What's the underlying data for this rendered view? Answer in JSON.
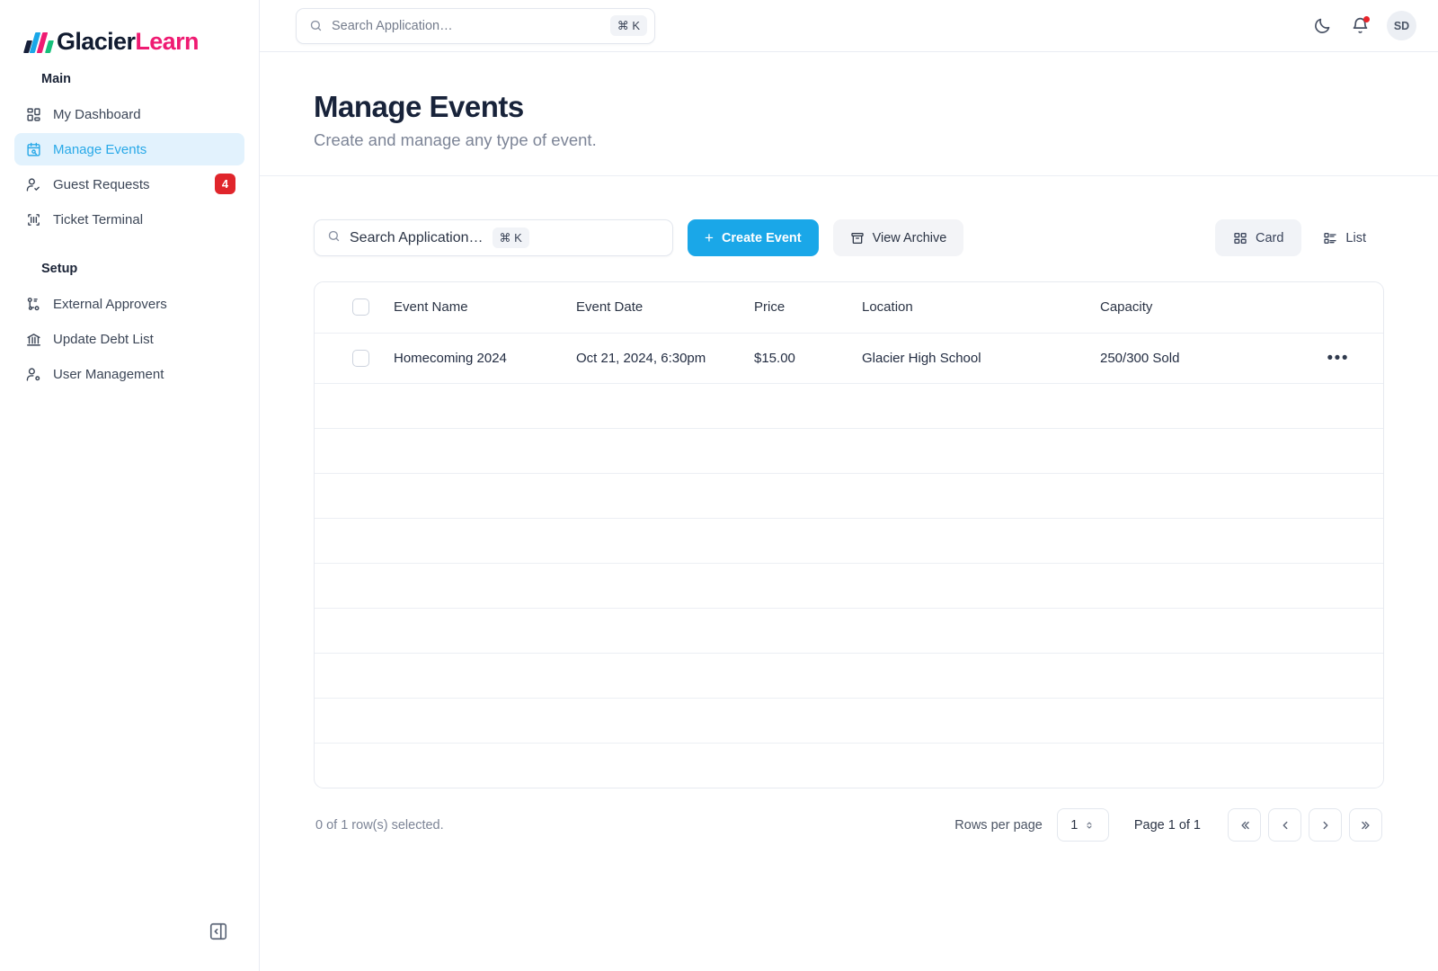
{
  "brand": {
    "name_part1": "Glacier",
    "name_part2": "Learn",
    "colors": {
      "accent_blue": "#1aa7e8",
      "accent_pink": "#ef1b72",
      "accent_green": "#17c07b",
      "badge_red": "#e0252b"
    }
  },
  "sidebar": {
    "sections": [
      {
        "title": "Main",
        "items": [
          {
            "label": "My Dashboard",
            "icon": "dashboard-icon",
            "active": false,
            "badge": null
          },
          {
            "label": "Manage Events",
            "icon": "calendar-search-icon",
            "active": true,
            "badge": null
          },
          {
            "label": "Guest Requests",
            "icon": "user-check-icon",
            "active": false,
            "badge": "4"
          },
          {
            "label": "Ticket Terminal",
            "icon": "barcode-icon",
            "active": false,
            "badge": null
          }
        ]
      },
      {
        "title": "Setup",
        "items": [
          {
            "label": "External Approvers",
            "icon": "workflow-icon",
            "active": false,
            "badge": null
          },
          {
            "label": "Update Debt List",
            "icon": "bank-icon",
            "active": false,
            "badge": null
          },
          {
            "label": "User Management",
            "icon": "user-cog-icon",
            "active": false,
            "badge": null
          }
        ]
      }
    ],
    "collapse_icon": "panel-collapse-icon"
  },
  "topbar": {
    "search": {
      "placeholder": "Search Application…",
      "shortcut": "⌘ K"
    },
    "theme_toggle_icon": "moon-icon",
    "notifications_icon": "bell-icon",
    "avatar_initials": "SD"
  },
  "header": {
    "title": "Manage Events",
    "subtitle": "Create and manage any type of event."
  },
  "toolbar": {
    "search": {
      "placeholder": "Search Application…",
      "shortcut": "⌘ K"
    },
    "create_label": "Create Event",
    "archive_label": "View Archive",
    "views": [
      {
        "label": "Card",
        "icon": "grid-icon",
        "active": true
      },
      {
        "label": "List",
        "icon": "list-icon",
        "active": false
      }
    ]
  },
  "table": {
    "columns": [
      "Event Name",
      "Event Date",
      "Price",
      "Location",
      "Capacity"
    ],
    "rows": [
      {
        "event_name": "Homecoming 2024",
        "event_date": "Oct 21, 2024, 6:30pm",
        "price": "$15.00",
        "location": "Glacier High School",
        "capacity": "250/300 Sold",
        "actions_icon": "ellipsis-icon"
      }
    ],
    "empty_row_count": 9
  },
  "footer": {
    "selection_text": "0 of 1 row(s) selected.",
    "rows_per_page_label": "Rows per page",
    "rows_per_page_value": "1",
    "page_label": "Page 1 of 1",
    "nav": [
      {
        "name": "first-page",
        "glyph": "«"
      },
      {
        "name": "prev-page",
        "glyph": "‹"
      },
      {
        "name": "next-page",
        "glyph": "›"
      },
      {
        "name": "last-page",
        "glyph": "»"
      }
    ]
  }
}
